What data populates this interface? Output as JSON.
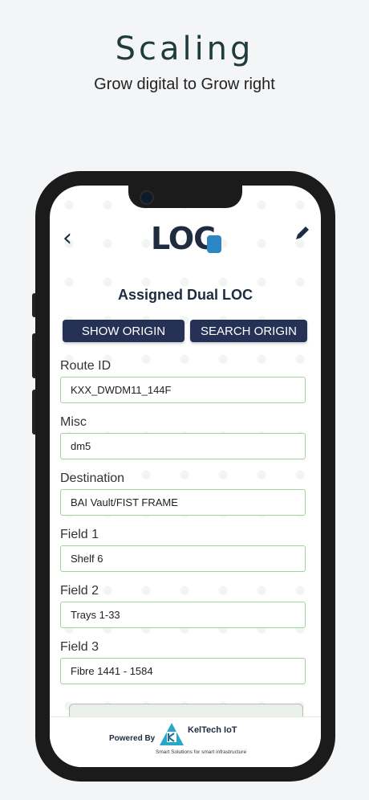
{
  "promo": {
    "headline": "Scaling",
    "subhead": "Grow digital to Grow right"
  },
  "app": {
    "back_icon": "chevron-left-icon",
    "logo_text": "LOC",
    "edit_icon": "pencil-icon",
    "page_title": "Assigned Dual LOC",
    "buttons": {
      "show_origin": "SHOW ORIGIN",
      "search_origin": "SEARCH ORIGIN"
    },
    "fields": [
      {
        "label": "Route ID",
        "value": "KXX_DWDM11_144F"
      },
      {
        "label": "Misc",
        "value": "dm5"
      },
      {
        "label": "Destination",
        "value": "BAI Vault/FIST FRAME"
      },
      {
        "label": "Field 1",
        "value": "Shelf 6"
      },
      {
        "label": "Field 2",
        "value": "Trays 1-33"
      },
      {
        "label": "Field 3",
        "value": "Fibre 1441 - 1584"
      }
    ],
    "footer": {
      "powered_by": "Powered By",
      "brand": "KelTech IoT",
      "tagline": "Smart Solutions for smart infrastructure"
    }
  },
  "colors": {
    "navy": "#253255",
    "field_border": "#9ed59b",
    "background": "#f4f5f7"
  }
}
